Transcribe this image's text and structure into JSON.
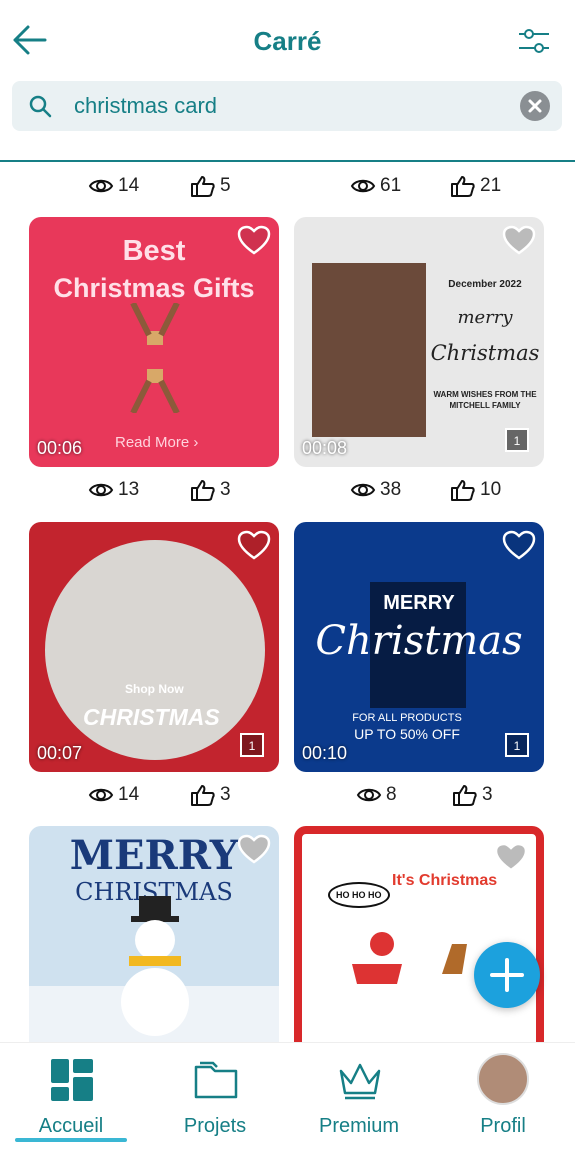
{
  "header": {
    "title": "Carré"
  },
  "search": {
    "value": "christmas card"
  },
  "grid": {
    "top_stats": [
      {
        "views": "14",
        "likes": "5"
      },
      {
        "views": "61",
        "likes": "21"
      }
    ],
    "cards": [
      {
        "id": "c1",
        "duration": "00:06",
        "line1": "Best",
        "line2": "Christmas Gifts",
        "readmore": "Read More ›",
        "stats": {
          "views": "13",
          "likes": "3"
        }
      },
      {
        "id": "c2",
        "duration": "00:08",
        "date": "December 2022",
        "merry": "merry",
        "xmas": "Christmas",
        "wish": "WARM WISHES FROM THE MITCHELL FAMILY",
        "pages": "1",
        "stats": {
          "views": "38",
          "likes": "10"
        }
      },
      {
        "id": "c3",
        "duration": "00:07",
        "shop": "Shop Now",
        "xmas": "CHRISTMAS",
        "pages": "1",
        "stats": {
          "views": "14",
          "likes": "3"
        }
      },
      {
        "id": "c4",
        "duration": "00:10",
        "merry": "MERRY",
        "xmas": "Christmas",
        "for": "FOR ALL PRODUCTS",
        "upto": "UP TO 50% OFF",
        "pages": "1",
        "stats": {
          "views": "8",
          "likes": "3"
        }
      },
      {
        "id": "c5",
        "merry": "MERRY",
        "xmas": "CHRISTMAS"
      },
      {
        "id": "c6",
        "its": "It's Christmas",
        "ho": "HO HO HO"
      }
    ]
  },
  "nav": {
    "items": [
      {
        "label": "Accueil",
        "icon": "dashboard-icon"
      },
      {
        "label": "Projets",
        "icon": "folder-icon"
      },
      {
        "label": "Premium",
        "icon": "crown-icon"
      },
      {
        "label": "Profil",
        "icon": "avatar"
      }
    ]
  },
  "colors": {
    "accent": "#167f86",
    "fab": "#1ca1dd",
    "indicator": "#3ab7d4"
  }
}
